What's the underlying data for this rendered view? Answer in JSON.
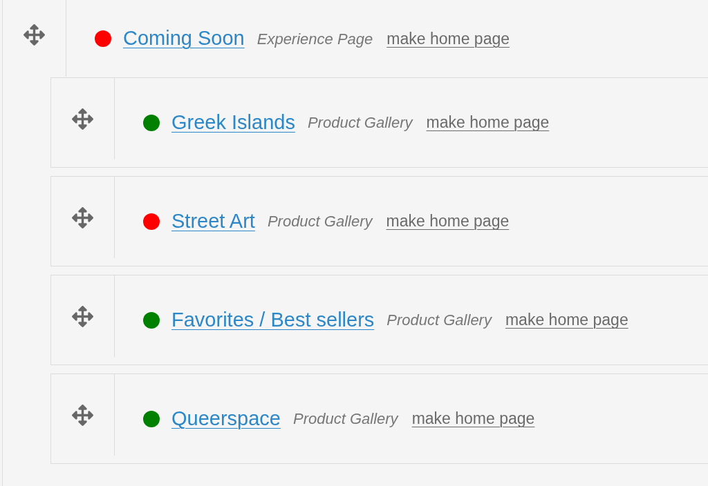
{
  "pages": [
    {
      "title": "Coming Soon",
      "color": "#ff0000",
      "type": "Experience Page",
      "action": "make home page",
      "children": [
        {
          "title": "Greek Islands",
          "color": "#008000",
          "type": "Product Gallery",
          "action": "make home page"
        },
        {
          "title": "Street Art",
          "color": "#ff0000",
          "type": "Product Gallery",
          "action": "make home page"
        },
        {
          "title": "Favorites / Best sellers",
          "color": "#008000",
          "type": "Product Gallery",
          "action": "make home page"
        },
        {
          "title": "Queerspace",
          "color": "#008000",
          "type": "Product Gallery",
          "action": "make home page"
        }
      ]
    }
  ]
}
